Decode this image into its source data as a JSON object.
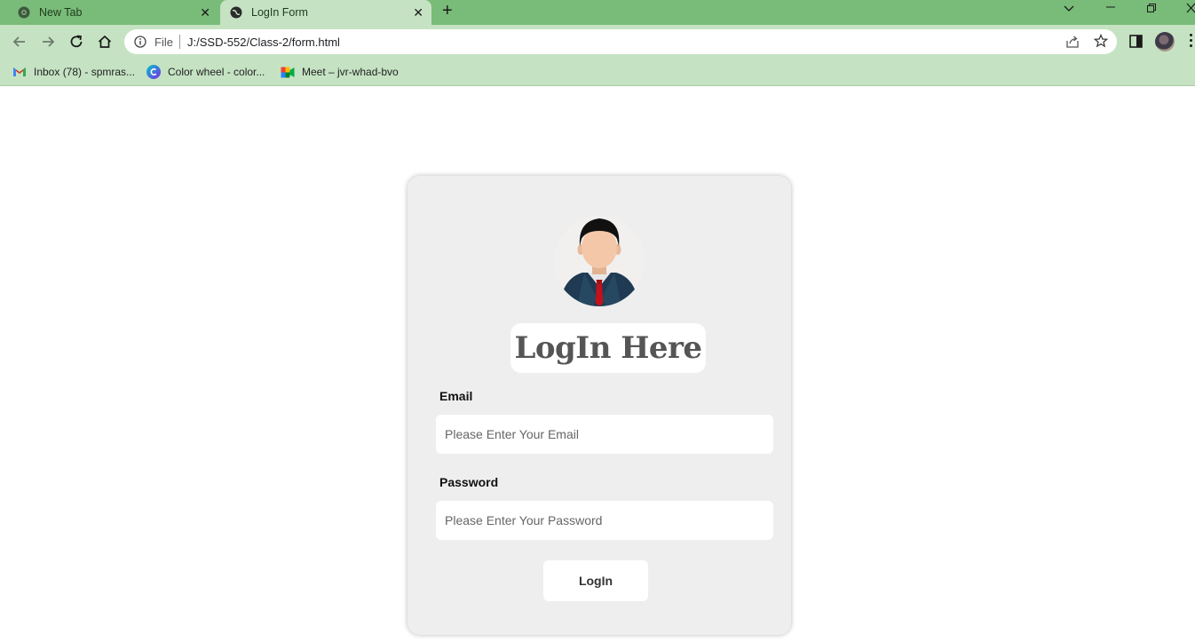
{
  "browser": {
    "tabs": [
      {
        "title": "New Tab",
        "active": false
      },
      {
        "title": "LogIn Form",
        "active": true
      }
    ],
    "omnibox": {
      "scheme_label": "File",
      "url": "J:/SSD-552/Class-2/form.html"
    },
    "bookmarks": [
      {
        "label": "Inbox (78) - spmras...",
        "icon": "gmail-icon"
      },
      {
        "label": "Color wheel - color...",
        "icon": "canva-icon"
      },
      {
        "label": "Meet – jvr-whad-bvo",
        "icon": "google-meet-icon"
      }
    ],
    "colors": {
      "frame": "#79bb78",
      "toolbar": "#c5e3c3"
    }
  },
  "page": {
    "heading": "LogIn Here",
    "email": {
      "label": "Email",
      "placeholder": "Please Enter Your Email",
      "value": ""
    },
    "password": {
      "label": "Password",
      "placeholder": "Please Enter Your Password",
      "value": ""
    },
    "submit_label": "LogIn",
    "colors": {
      "card": "#eeeeee",
      "heading": "#555555"
    }
  }
}
